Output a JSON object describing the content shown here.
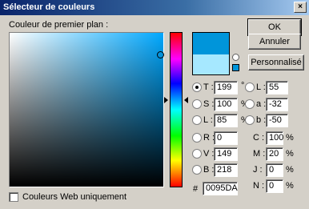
{
  "window": {
    "title": "Sélecteur de couleurs",
    "close_glyph": "×"
  },
  "labels": {
    "foreground": "Couleur de premier plan :"
  },
  "buttons": {
    "ok": "OK",
    "cancel": "Annuler",
    "custom": "Personnalisé"
  },
  "colors": {
    "new": "#0095da",
    "previous": "#a6e8ff"
  },
  "hsb": [
    {
      "label": "T :",
      "value": "199",
      "unit": "°",
      "selected": true
    },
    {
      "label": "S :",
      "value": "100",
      "unit": "%",
      "selected": false
    },
    {
      "label": "L :",
      "value": "85",
      "unit": "%",
      "selected": false
    }
  ],
  "rgb": [
    {
      "label": "R :",
      "value": "0"
    },
    {
      "label": "V :",
      "value": "149"
    },
    {
      "label": "B :",
      "value": "218"
    }
  ],
  "lab": [
    {
      "label": "L :",
      "value": "55"
    },
    {
      "label": "a :",
      "value": "-32"
    },
    {
      "label": "b :",
      "value": "-50"
    }
  ],
  "cmyk": [
    {
      "label": "C :",
      "value": "100",
      "unit": "%"
    },
    {
      "label": "M :",
      "value": "20",
      "unit": "%"
    },
    {
      "label": "J :",
      "value": "0",
      "unit": "%"
    },
    {
      "label": "N :",
      "value": "0",
      "unit": "%"
    }
  ],
  "hex": {
    "prefix": "#",
    "value": "0095DA"
  },
  "web_only": {
    "label": "Couleurs Web uniquement",
    "checked": false
  }
}
